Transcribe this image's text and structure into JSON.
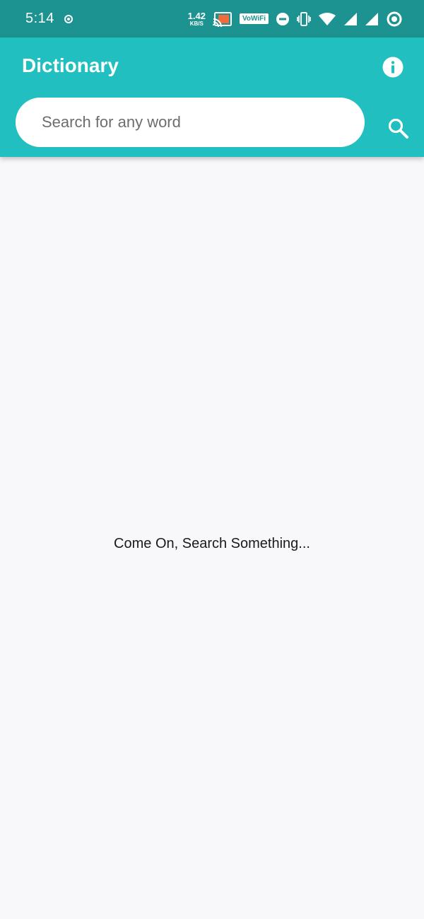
{
  "status_bar": {
    "time": "5:14",
    "net_speed_value": "1.42",
    "net_speed_unit": "KB/S",
    "vowifi_label": "VoWiFi",
    "icons": [
      "record-icon",
      "cast-icon",
      "do-not-disturb-icon",
      "vibrate-icon",
      "wifi-icon",
      "signal-icon",
      "signal-icon-2",
      "battery-saver-icon"
    ]
  },
  "app_bar": {
    "title": "Dictionary",
    "info_icon": "info-icon",
    "color": "#21bfbf"
  },
  "search": {
    "placeholder": "Search for any word",
    "value": "",
    "icon": "search-icon"
  },
  "main": {
    "empty_message": "Come On, Search Something..."
  },
  "colors": {
    "status_bar": "#1c9390",
    "accent": "#21bfbf",
    "background": "#f8f7fa"
  }
}
